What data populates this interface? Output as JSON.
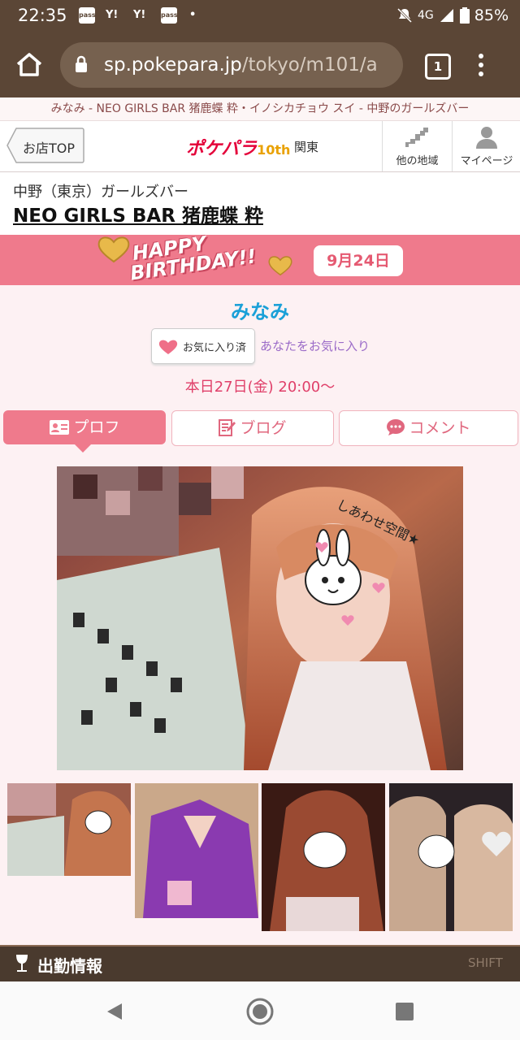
{
  "status_bar": {
    "time": "22:35",
    "notif_icons": [
      "pass",
      "Y!",
      "Y!",
      "pass",
      "•"
    ],
    "network": "4G",
    "battery": "85%"
  },
  "browser": {
    "url_host": "sp.pokepara.jp",
    "url_path": "/tokyo/m101/a",
    "tab_count": "1"
  },
  "breadcrumb": "みなみ - NEO GIRLS BAR 猪鹿蝶 粋・イノシカチョウ スイ - 中野のガールズバー",
  "site_header": {
    "shop_top_label": "お店TOP",
    "logo_text": "ポケパラ",
    "logo_badge": "10th",
    "region": "関東",
    "other_area_label": "他の地域",
    "mypage_label": "マイページ"
  },
  "shop": {
    "area_category": "中野（東京）ガールズバー",
    "name": "NEO GIRLS BAR 猪鹿蝶 粋"
  },
  "birthday": {
    "title_line1": "HAPPY",
    "title_line2": "BIRTHDAY!!",
    "date": "9月24日"
  },
  "profile": {
    "name": "みなみ",
    "favorite_button": "お気に入り済",
    "favorite_you": "あなたをお気に入り",
    "schedule": "本日27日(金) 20:00〜",
    "photo_overlay_text": "しあわせ空間★"
  },
  "tabs": [
    {
      "label": "プロフ",
      "active": true
    },
    {
      "label": "ブログ",
      "active": false
    },
    {
      "label": "コメント",
      "active": false
    }
  ],
  "attendance": {
    "title": "出勤情報",
    "shift_label": "SHIFT"
  },
  "colors": {
    "brown": "#5b4636",
    "pink": "#ef7a8c",
    "name_blue": "#1aa0d8",
    "schedule_red": "#e0406a"
  }
}
